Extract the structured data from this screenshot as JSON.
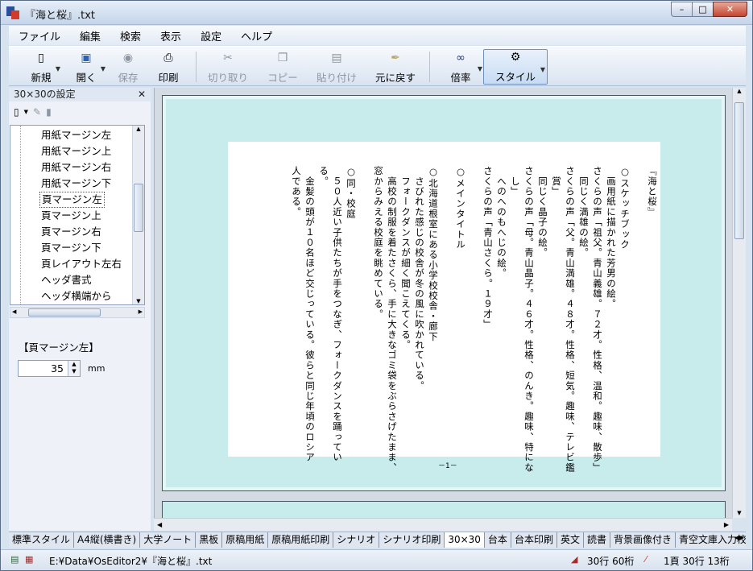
{
  "window": {
    "title": "『海と桜』.txt",
    "min": "–",
    "max": "□",
    "close": "✕"
  },
  "menu": [
    "ファイル",
    "編集",
    "検索",
    "表示",
    "設定",
    "ヘルプ"
  ],
  "toolbar": {
    "new": "新規",
    "open": "開く",
    "save": "保存",
    "print": "印刷",
    "cut": "切り取り",
    "copy": "コピー",
    "paste": "貼り付け",
    "undo": "元に戻す",
    "zoom": "倍率",
    "style": "スタイル"
  },
  "panel": {
    "title": "30×30の設定",
    "close": "✕",
    "tree_items": [
      "用紙マージン左",
      "用紙マージン上",
      "用紙マージン右",
      "用紙マージン下",
      "頁マージン左",
      "頁マージン上",
      "頁マージン右",
      "頁マージン下",
      "頁レイアウト左右",
      "ヘッダ書式",
      "ヘッダ横端から"
    ],
    "selected_index": 4,
    "setting_label": "【頁マージン左】",
    "setting_value": "35",
    "setting_unit": "mm"
  },
  "document": {
    "lines": [
      "『海と桜』",
      "",
      "○スケッチブック",
      "　画用紙に描かれた芳男の絵。",
      "さくらの声「祖父。青山義雄。７２才。性格、温和。趣味、散歩」",
      "　同じく満雄の絵。",
      "さくらの声「父。青山満雄。４８才。性格、短気。趣味、テレビ鑑",
      "　賞」",
      "　同じく晶子の絵。",
      "さくらの声「母。青山晶子。４６才。性格、のんき。趣味、特にな",
      "　し」",
      "　へのへのもへじの絵。",
      "さくらの声「青山さくら。１９才」",
      "",
      "○メインタイトル",
      "",
      "○北海道根室にある小学校校舎・廊下",
      "　さびれた感じの校舎が冬の風に吹かれている。",
      "　フォークダンスが細く聞こえてくる。",
      "　高校の制服を着たさくら、手に大きなゴミ袋をぶらさげたまま、",
      "窓からみえる校庭を眺めている。",
      "",
      "○同・校庭",
      "　５０人近い子供たちが手をつなぎ、フォークダンスを踊ってい",
      "る。",
      "　金髪の頭が１０名ほど交じっている。彼らと同じ年頃のロシア",
      "人である。"
    ],
    "page_number": "－1－"
  },
  "tabs": [
    "標準スタイル",
    "A4縦(横書き)",
    "大学ノート",
    "黒板",
    "原稿用紙",
    "原稿用紙印刷",
    "シナリオ",
    "シナリオ印刷",
    "30×30",
    "台本",
    "台本印刷",
    "英文",
    "読書",
    "背景画像付き",
    "青空文庫入力校正"
  ],
  "active_tab": 8,
  "status": {
    "path": "E:¥Data¥OsEditor2¥『海と桜』.txt",
    "grid": "30行 60桁",
    "position": "1頁 30行 13桁"
  }
}
